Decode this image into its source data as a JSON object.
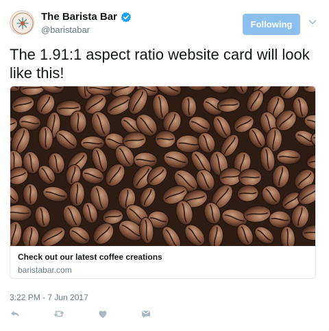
{
  "author": {
    "display_name": "The Barista Bar",
    "handle": "@baristabar",
    "verified": true,
    "avatar_icon": "coffee-logo-icon"
  },
  "follow_button": {
    "label": "Following",
    "color": "#8ac0eb"
  },
  "tweet": {
    "text": "The 1.91:1 aspect ratio website card will look like this!",
    "timestamp": "3:22 PM - 7 Jun 2017"
  },
  "card": {
    "image_icon": "coffee-beans-photo",
    "title": "Check out our latest coffee creations",
    "domain": "baristabar.com"
  },
  "actions": [
    {
      "icon": "reply-icon"
    },
    {
      "icon": "retweet-icon"
    },
    {
      "icon": "like-icon"
    },
    {
      "icon": "direct-message-icon"
    }
  ],
  "colors": {
    "text": "#14171a",
    "secondary_text": "#657786",
    "verified_blue": "#1da1f2",
    "border": "#e1e8ed"
  }
}
